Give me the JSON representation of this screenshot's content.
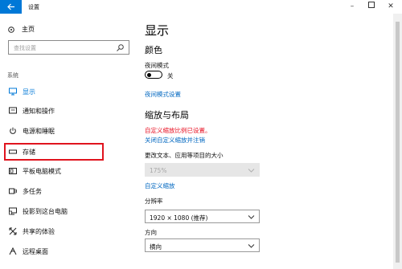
{
  "window": {
    "title": "设置"
  },
  "sidebar": {
    "home_label": "主页",
    "search_placeholder": "查找设置",
    "section_label": "系统",
    "items": [
      {
        "label": "显示",
        "icon": "display-icon"
      },
      {
        "label": "通知和操作",
        "icon": "notification-icon"
      },
      {
        "label": "电源和睡眠",
        "icon": "power-icon"
      },
      {
        "label": "存储",
        "icon": "storage-icon"
      },
      {
        "label": "平板电脑模式",
        "icon": "tablet-mode-icon"
      },
      {
        "label": "多任务",
        "icon": "multitasking-icon"
      },
      {
        "label": "投影到这台电脑",
        "icon": "project-icon"
      },
      {
        "label": "共享的体验",
        "icon": "shared-experience-icon"
      },
      {
        "label": "远程桌面",
        "icon": "remote-desktop-icon"
      }
    ]
  },
  "main": {
    "title": "显示",
    "color_heading": "颜色",
    "night_light_label": "夜间模式",
    "night_light_state": "关",
    "night_light_settings_link": "夜间模式设置",
    "scale_heading": "缩放与布局",
    "custom_scale_warning": "自定义缩放比例已设置。",
    "custom_scale_off_link": "关闭自定义缩放并注销",
    "text_size_label": "更改文本、应用等项目的大小",
    "text_size_value": "175%",
    "custom_scale_link": "自定义缩放",
    "resolution_label": "分辨率",
    "resolution_value": "1920 × 1080 (推荐)",
    "orientation_label": "方向",
    "orientation_value": "横向"
  },
  "colors": {
    "accent": "#0078d7",
    "warning": "#e81123",
    "highlight": "#e0141e"
  }
}
